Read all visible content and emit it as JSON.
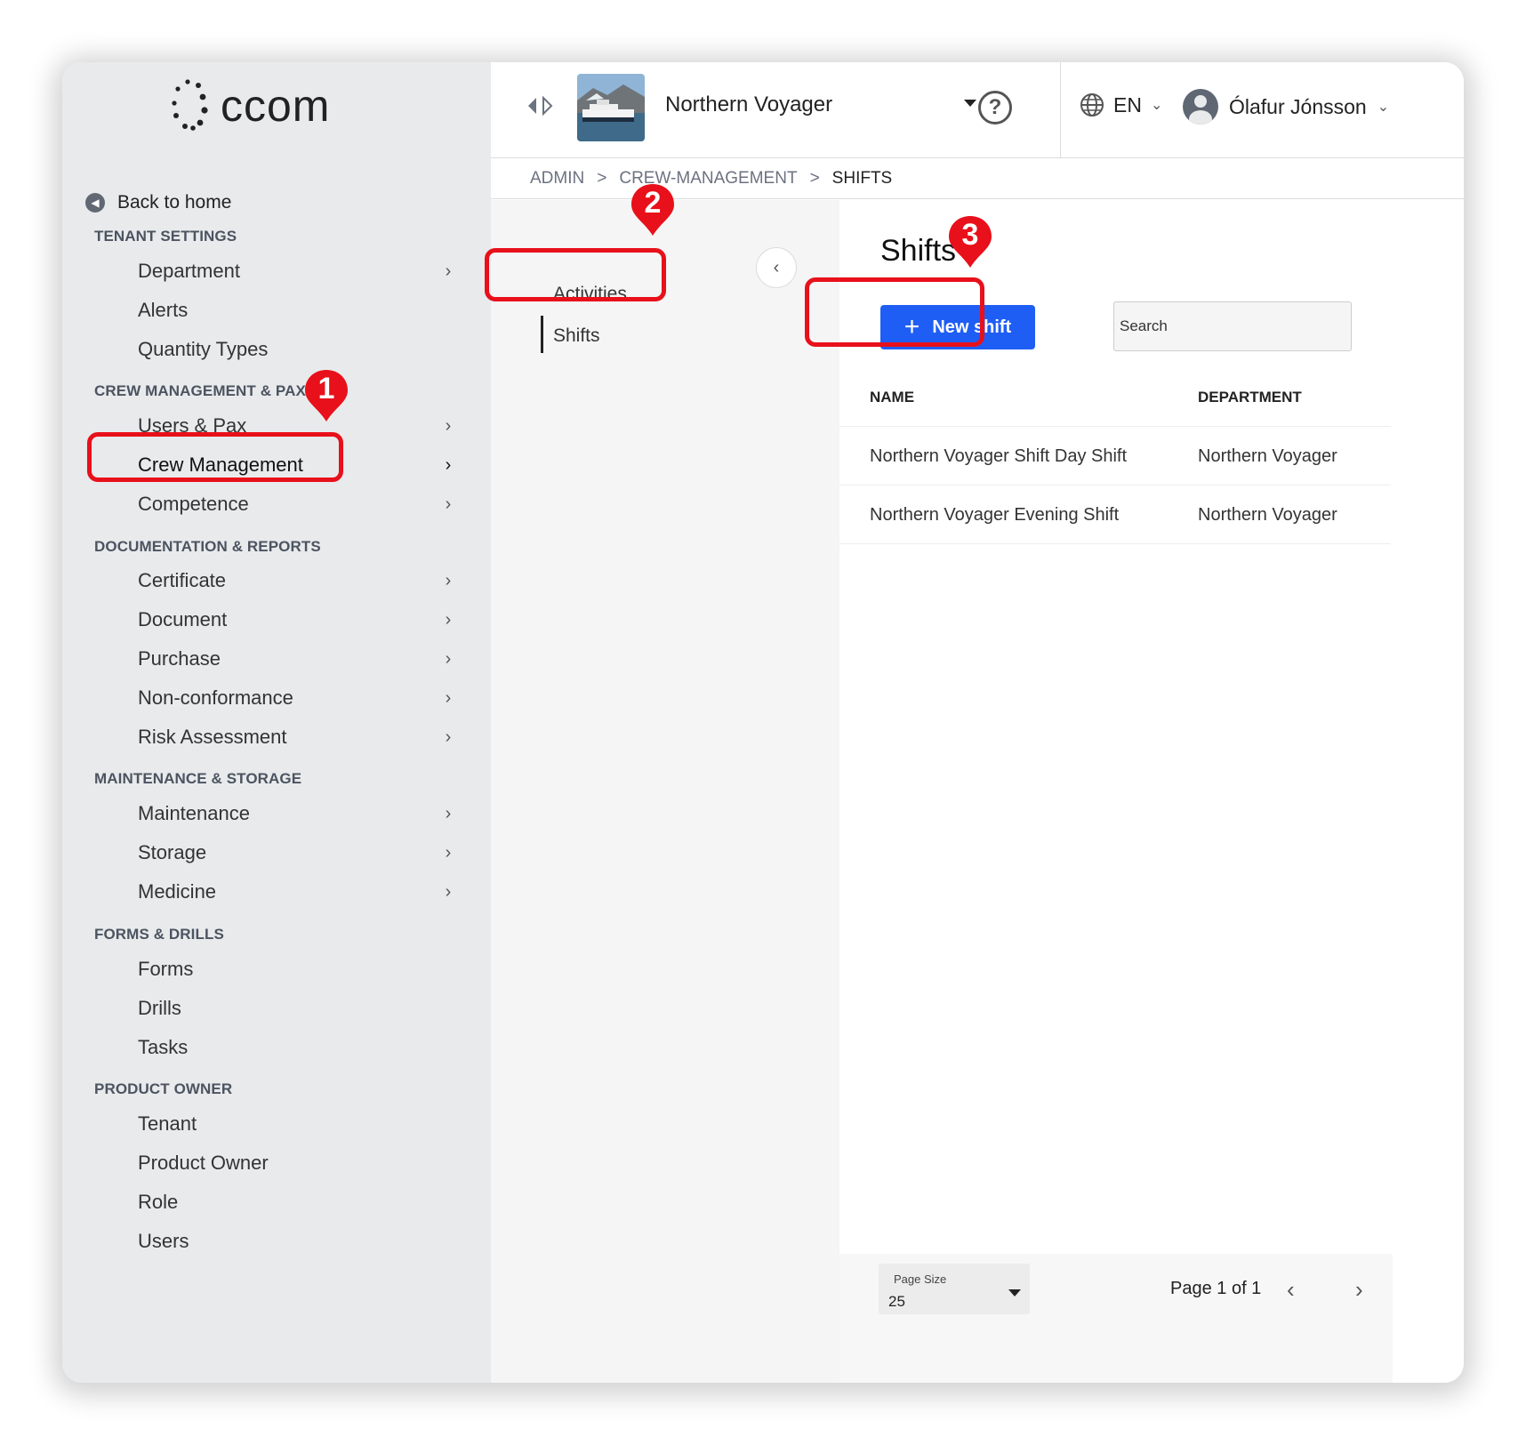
{
  "brand": {
    "name": "ccom"
  },
  "sidebar": {
    "back_label": "Back to home",
    "sections": [
      {
        "title": "TENANT SETTINGS",
        "items": [
          {
            "label": "Department",
            "chevron": true
          },
          {
            "label": "Alerts",
            "chevron": false
          },
          {
            "label": "Quantity Types",
            "chevron": false
          }
        ]
      },
      {
        "title": "CREW MANAGEMENT & PAX",
        "items": [
          {
            "label": "Users & Pax",
            "chevron": true
          },
          {
            "label": "Crew Management",
            "chevron": true,
            "active": true
          },
          {
            "label": "Competence",
            "chevron": true
          }
        ]
      },
      {
        "title": "DOCUMENTATION & REPORTS",
        "items": [
          {
            "label": "Certificate",
            "chevron": true
          },
          {
            "label": "Document",
            "chevron": true
          },
          {
            "label": "Purchase",
            "chevron": true
          },
          {
            "label": "Non-conformance",
            "chevron": true
          },
          {
            "label": "Risk Assessment",
            "chevron": true
          }
        ]
      },
      {
        "title": "MAINTENANCE & STORAGE",
        "items": [
          {
            "label": "Maintenance",
            "chevron": true
          },
          {
            "label": "Storage",
            "chevron": true
          },
          {
            "label": "Medicine",
            "chevron": true
          }
        ]
      },
      {
        "title": "FORMS & DRILLS",
        "items": [
          {
            "label": "Forms",
            "chevron": false
          },
          {
            "label": "Drills",
            "chevron": false
          },
          {
            "label": "Tasks",
            "chevron": false
          }
        ]
      },
      {
        "title": "PRODUCT OWNER",
        "items": [
          {
            "label": "Tenant",
            "chevron": false
          },
          {
            "label": "Product Owner",
            "chevron": false
          },
          {
            "label": "Role",
            "chevron": false
          },
          {
            "label": "Users",
            "chevron": false
          }
        ]
      }
    ]
  },
  "header": {
    "vessel_name": "Northern Voyager",
    "help_icon": "?",
    "language": "EN",
    "user_name": "Ólafur Jónsson"
  },
  "breadcrumb": {
    "items": [
      "ADMIN",
      "CREW-MANAGEMENT",
      "SHIFTS"
    ],
    "separator": ">"
  },
  "subnav": {
    "items": [
      "Activities",
      "Shifts"
    ],
    "active": "Shifts"
  },
  "main": {
    "title": "Shifts",
    "new_button_label": "New shift",
    "search_placeholder": "Search",
    "columns": [
      "NAME",
      "DEPARTMENT"
    ],
    "rows": [
      {
        "name": "Northern Voyager Shift Day Shift",
        "department": "Northern Voyager"
      },
      {
        "name": "Northern Voyager Evening Shift",
        "department": "Northern Voyager"
      }
    ],
    "footer": {
      "page_size_label": "Page Size",
      "page_size_value": "25",
      "page_info": "Page 1 of 1"
    }
  },
  "annotations": {
    "markers": [
      "1",
      "2",
      "3"
    ],
    "highlight_color": "#e8101a"
  },
  "colors": {
    "accent": "#1f5ef5",
    "sidebar_bg": "#e9eaec",
    "annotation_red": "#e8101a"
  }
}
